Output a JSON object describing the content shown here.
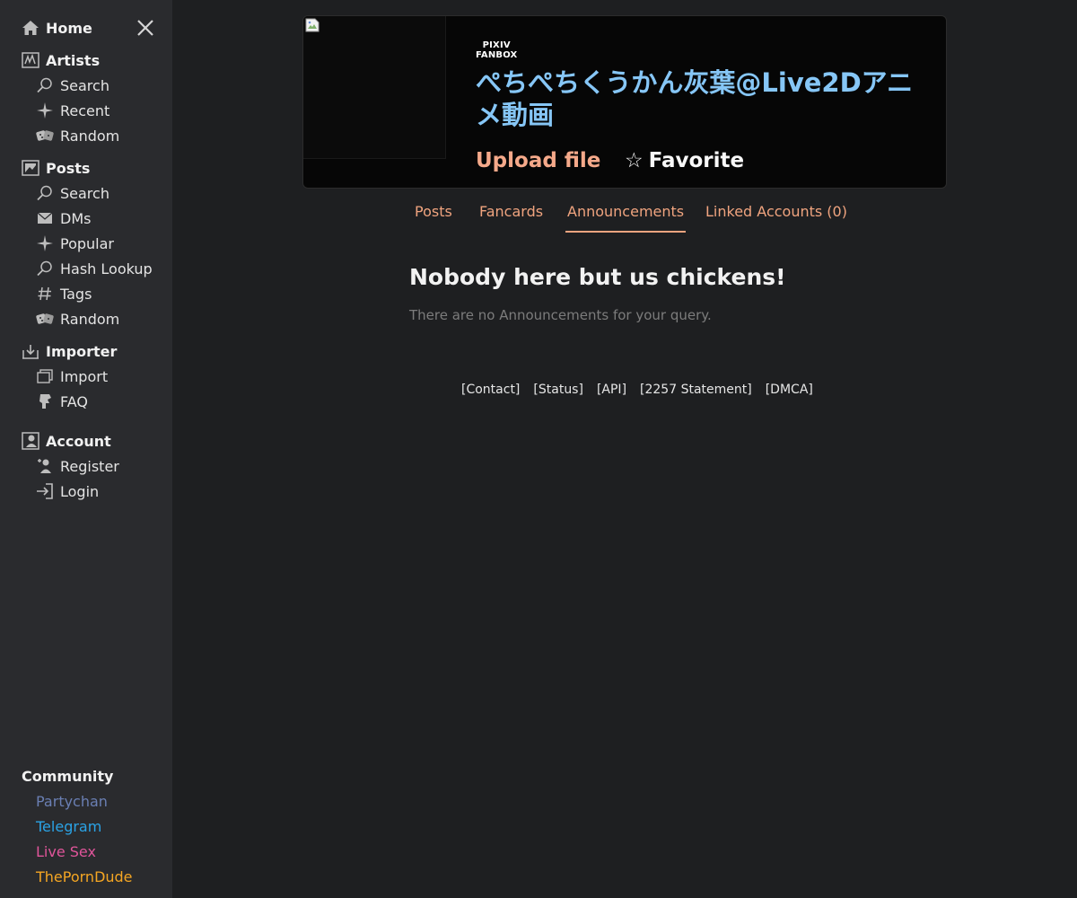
{
  "sidebar": {
    "home": {
      "label": "Home",
      "icon": "home-icon"
    },
    "close": {
      "icon": "close-icon"
    },
    "artists": {
      "label": "Artists",
      "items": [
        {
          "label": "Search",
          "icon": "search-icon"
        },
        {
          "label": "Recent",
          "icon": "sparkle-icon"
        },
        {
          "label": "Random",
          "icon": "dice-icon"
        }
      ]
    },
    "posts": {
      "label": "Posts",
      "items": [
        {
          "label": "Search",
          "icon": "search-icon"
        },
        {
          "label": "DMs",
          "icon": "mail-icon"
        },
        {
          "label": "Popular",
          "icon": "sparkle-icon"
        },
        {
          "label": "Hash Lookup",
          "icon": "search-icon"
        },
        {
          "label": "Tags",
          "icon": "hash-icon"
        },
        {
          "label": "Random",
          "icon": "dice-icon"
        }
      ]
    },
    "importer": {
      "label": "Importer",
      "items": [
        {
          "label": "Import",
          "icon": "import-icon"
        },
        {
          "label": "FAQ",
          "icon": "faq-icon"
        }
      ]
    },
    "account": {
      "label": "Account",
      "items": [
        {
          "label": "Register",
          "icon": "register-icon"
        },
        {
          "label": "Login",
          "icon": "login-icon"
        }
      ]
    },
    "community": {
      "label": "Community",
      "links": [
        {
          "label": "Partychan",
          "color": "#6a7fb3"
        },
        {
          "label": "Telegram",
          "color": "#2aa3e6"
        },
        {
          "label": "Live Sex",
          "color": "#e0559a"
        },
        {
          "label": "ThePornDude",
          "color": "#f5a623"
        }
      ]
    }
  },
  "header": {
    "service_logo_line1": "PIXIV",
    "service_logo_line2": "FANBOX",
    "artist_name": "ぺちぺちくうかん灰葉@Live2Dアニメ動画",
    "upload_label": "Upload file",
    "favorite_star": "☆",
    "favorite_label": "Favorite"
  },
  "tabs": [
    {
      "label": "Posts",
      "active": false
    },
    {
      "label": "Fancards",
      "active": false
    },
    {
      "label": "Announcements",
      "active": true
    },
    {
      "label": "Linked Accounts (0)",
      "active": false
    }
  ],
  "empty_state": {
    "title": "Nobody here but us chickens!",
    "subtitle": "There are no Announcements for your query."
  },
  "footer": {
    "links": [
      "[Contact]",
      "[Status]",
      "[API]",
      "[2257 Statement]",
      "[DMCA]"
    ]
  },
  "colors": {
    "accent": "#f0a47f",
    "artist_name": "#86c6f6",
    "sidebar_bg": "#2a2b2e",
    "page_bg": "#1e1f21"
  }
}
